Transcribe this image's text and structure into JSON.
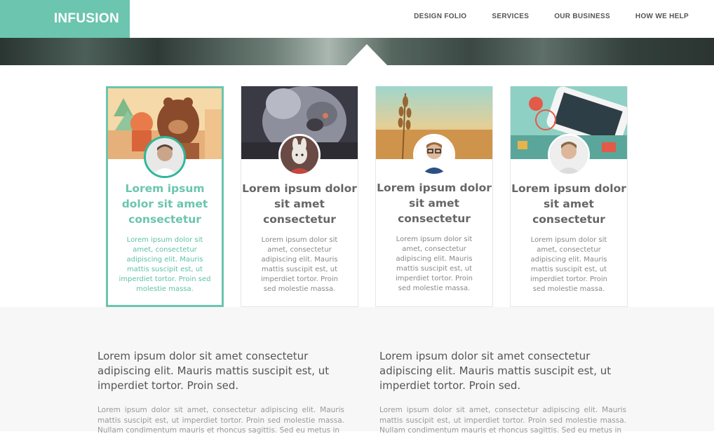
{
  "brand": {
    "logo_text": "INFUSION",
    "accent": "#6cc5ae"
  },
  "nav": {
    "items": [
      "DESIGN FOLIO",
      "SERVICES",
      "OUR BUSINESS",
      "HOW WE HELP"
    ]
  },
  "cards": [
    {
      "title": "Lorem ipsum dolor sit amet consectetur",
      "text": "Lorem ipsum dolor sit amet, consectetur adipiscing elit. Mauris mattis suscipit est, ut imperdiet tortor. Proin sed molestie massa.",
      "active": true
    },
    {
      "title": "Lorem ipsum dolor sit amet consectetur",
      "text": "Lorem ipsum dolor sit amet, consectetur adipiscing elit. Mauris mattis suscipit est, ut imperdiet tortor. Proin sed molestie massa.",
      "active": false
    },
    {
      "title": "Lorem ipsum dolor sit amet consectetur",
      "text": "Lorem ipsum dolor sit amet, consectetur adipiscing elit. Mauris mattis suscipit est, ut imperdiet tortor. Proin sed molestie massa.",
      "active": false
    },
    {
      "title": "Lorem ipsum dolor sit amet consectetur",
      "text": "Lorem ipsum dolor sit amet, consectetur adipiscing elit. Mauris mattis suscipit est, ut imperdiet tortor. Proin sed molestie massa.",
      "active": false
    }
  ],
  "features": [
    {
      "heading": "Lorem ipsum dolor sit amet consectetur adipiscing elit. Mauris mattis suscipit est, ut imperdiet tortor. Proin sed.",
      "body": "Lorem ipsum dolor sit amet, consectetur adipiscing elit. Mauris mattis suscipit est, ut imperdiet tortor. Proin sed molestie massa. Nullam condimentum mauris et rhoncus sagittis. Sed eu metus in"
    },
    {
      "heading": "Lorem ipsum dolor sit amet consectetur adipiscing elit. Mauris mattis suscipit est, ut imperdiet tortor. Proin sed.",
      "body": "Lorem ipsum dolor sit amet, consectetur adipiscing elit. Mauris mattis suscipit est, ut imperdiet tortor. Proin sed molestie massa. Nullam condimentum mauris et rhoncus sagittis. Sed eu metus in"
    }
  ]
}
